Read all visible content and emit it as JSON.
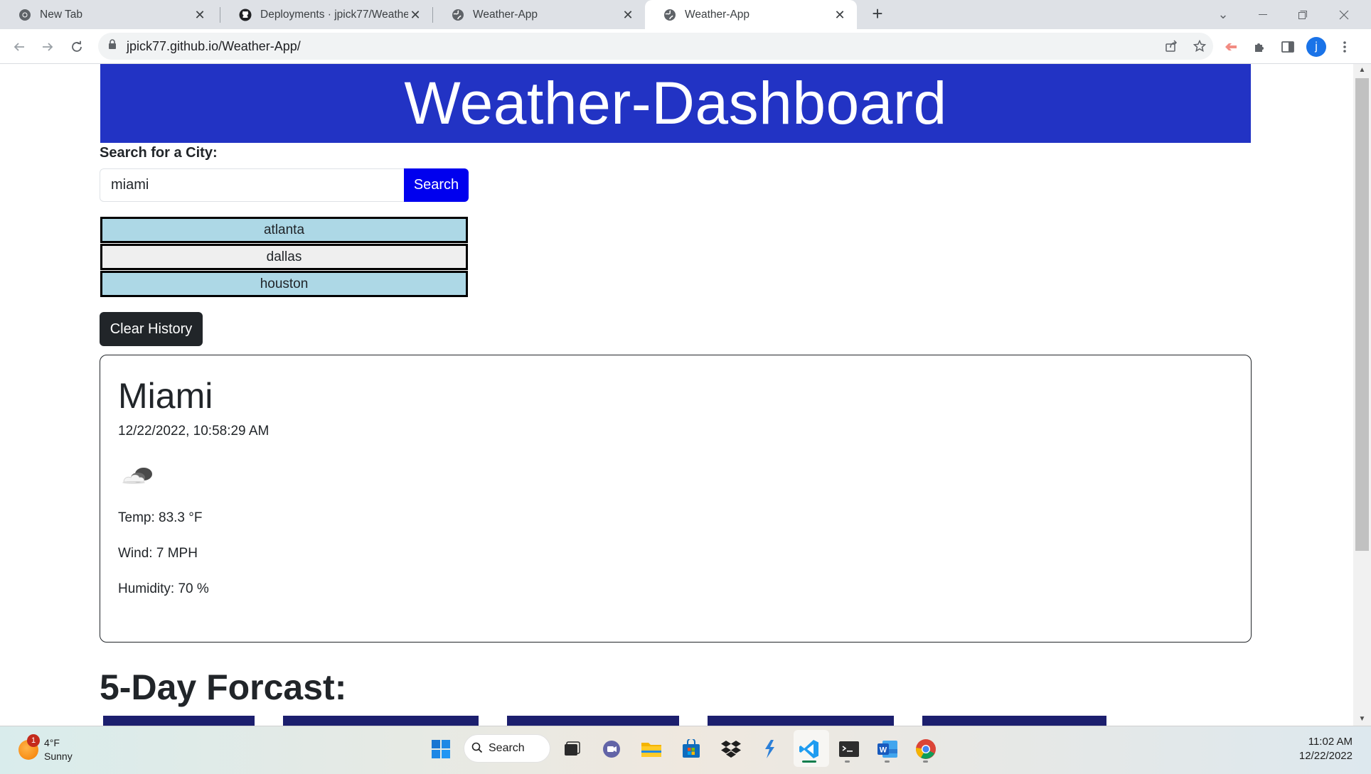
{
  "browser": {
    "tabs": [
      {
        "title": "New Tab",
        "icon": "chrome-icon"
      },
      {
        "title": "Deployments · jpick77/Weather-",
        "icon": "github-icon"
      },
      {
        "title": "Weather-App",
        "icon": "globe-icon"
      },
      {
        "title": "Weather-App",
        "icon": "globe-icon",
        "active": true
      }
    ],
    "url": "jpick77.github.io/Weather-App/",
    "profile_initial": "j"
  },
  "page": {
    "header_title": "Weather-Dashboard",
    "search": {
      "label": "Search for a City:",
      "value": "miami",
      "button_label": "Search"
    },
    "history": [
      {
        "city": "atlanta",
        "color": "#add8e6"
      },
      {
        "city": "dallas",
        "color": "#efefef"
      },
      {
        "city": "houston",
        "color": "#add8e6"
      }
    ],
    "clear_button_label": "Clear History",
    "current": {
      "city": "Miami",
      "datetime": "12/22/2022, 10:58:29 AM",
      "icon": "cloudy-icon",
      "temp": "Temp: 83.3 °F",
      "wind": "Wind: 7 MPH",
      "humidity": "Humidity: 70 %"
    },
    "forecast_title": "5-Day Forcast:",
    "colors": {
      "header_bg": "#2233c4",
      "search_button": "#0000ee",
      "forecast_card": "#1c1f6e"
    }
  },
  "taskbar": {
    "weather_temp": "4°F",
    "weather_desc": "Sunny",
    "weather_badge": "1",
    "search_label": "Search",
    "time": "11:02 AM",
    "date": "12/22/2022"
  }
}
